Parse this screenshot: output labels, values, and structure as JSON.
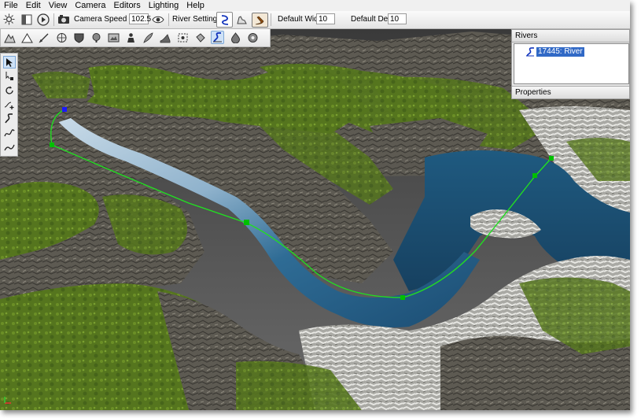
{
  "menu": [
    "File",
    "Edit",
    "View",
    "Camera",
    "Editors",
    "Lighting",
    "Help"
  ],
  "toolbar": {
    "camera_speed_label": "Camera Speed",
    "camera_speed_value": "102.5",
    "river_settings_label": "River Settings",
    "default_width_label": "Default Width",
    "default_width_value": "10",
    "default_depth_label": "Default Depth",
    "default_depth_value": "10"
  },
  "rivers_panel": {
    "title": "Rivers",
    "items": [
      {
        "label": "17445: River"
      }
    ],
    "properties_title": "Properties"
  },
  "colors": {
    "spline": "#22dd22",
    "node": "#00c000",
    "start_node": "#1a1aff",
    "selection": "#3169c6",
    "water": "#1f5a80"
  }
}
